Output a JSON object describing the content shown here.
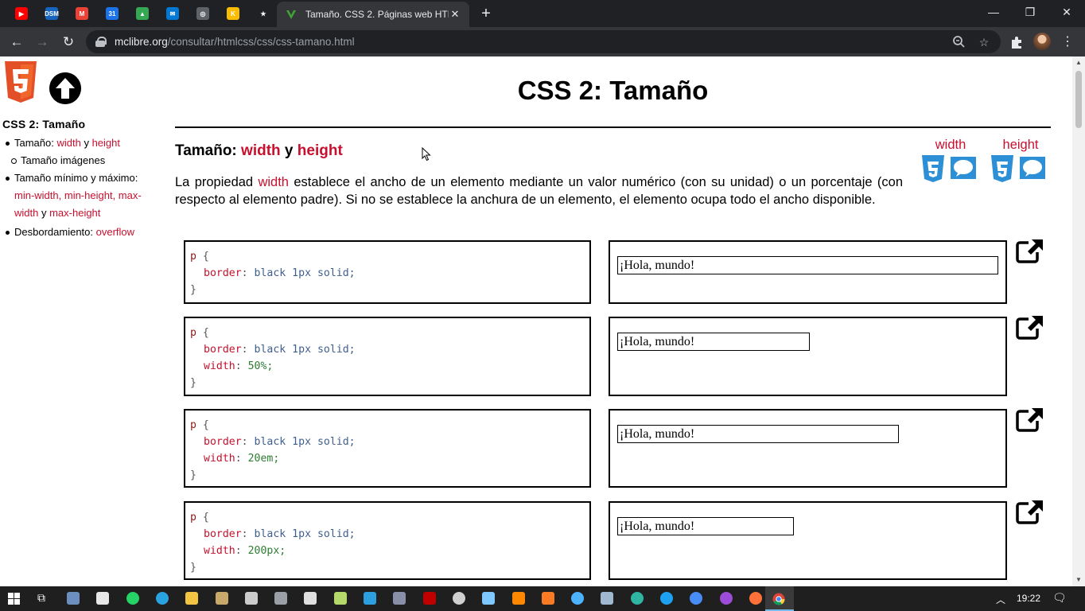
{
  "browser": {
    "tab_title": "Tamaño. CSS 2. Páginas web HTM",
    "url_host": "mclibre.org",
    "url_path": "/consultar/htmlcss/css/css-tamano.html",
    "pinned_tabs": [
      {
        "name": "youtube",
        "color": "#ff0000",
        "label": "▶"
      },
      {
        "name": "dsm",
        "color": "#1565c0",
        "label": "DSM"
      },
      {
        "name": "gmail",
        "color": "#ea4335",
        "label": "M"
      },
      {
        "name": "calendar",
        "color": "#1a73e8",
        "label": "31"
      },
      {
        "name": "drive",
        "color": "#34a853",
        "label": "▲"
      },
      {
        "name": "mail",
        "color": "#0078d4",
        "label": "✉"
      },
      {
        "name": "chrome-app",
        "color": "#5f6368",
        "label": "◎"
      },
      {
        "name": "keep",
        "color": "#fbbc04",
        "label": "K"
      },
      {
        "name": "bookmarks",
        "color": "#202124",
        "label": "★"
      }
    ]
  },
  "sidebar": {
    "title": "CSS 2: Tamaño",
    "item1_text": "Tamaño: ",
    "item1_link_a": "width",
    "item1_and": " y ",
    "item1_link_b": "height",
    "item1_sub": "Tamaño imágenes",
    "item2_text": "Tamaño mínimo y máximo: ",
    "item2_link_a": "min-width",
    "item2_sep1": ", ",
    "item2_link_b": "min-height",
    "item2_sep2": ", ",
    "item2_link_c": "max-width",
    "item2_and": " y ",
    "item2_link_d": "max-height",
    "item3_text": "Desbordamiento: ",
    "item3_link": "overflow"
  },
  "main": {
    "title": "CSS 2: Tamaño",
    "section_prefix": "Tamaño: ",
    "section_link_a": "width",
    "section_and": " y ",
    "section_link_b": "height",
    "prop_links": [
      "width",
      "height"
    ],
    "intro_before": "La propiedad ",
    "intro_link": "width",
    "intro_after": " establece el ancho de un elemento mediante un valor numérico (con su unidad) o un porcentaje (con respecto al elemento padre). Si no se establece la anchura de un elemento, el elemento ocupa todo el ancho disponible."
  },
  "examples": [
    {
      "selector": "p",
      "open": "{",
      "border_prop": "border",
      "border_val": "black 1px solid;",
      "width_prop": "",
      "width_val": "",
      "close": "}",
      "result": "¡Hola, mundo!",
      "result_width_fraction": 1.0
    },
    {
      "selector": "p",
      "open": "{",
      "border_prop": "border",
      "border_val": "black 1px solid;",
      "width_prop": "width",
      "width_val": "50%;",
      "close": "}",
      "result": "¡Hola, mundo!",
      "result_width_fraction": 0.5
    },
    {
      "selector": "p",
      "open": "{",
      "border_prop": "border",
      "border_val": "black 1px solid;",
      "width_prop": "width",
      "width_val": "20em;",
      "close": "}",
      "result": "¡Hola, mundo!",
      "result_width_fraction": 0.72
    },
    {
      "selector": "p",
      "open": "{",
      "border_prop": "border",
      "border_val": "black 1px solid;",
      "width_prop": "width",
      "width_val": "200px;",
      "close": "}",
      "result": "¡Hola, mundo!",
      "result_width_fraction": 0.46
    }
  ],
  "taskbar": {
    "clock": "19:22"
  },
  "colors": {
    "link_red": "#c8102e",
    "chrome_dark": "#202124",
    "css_blue": "#2d8fd5"
  }
}
